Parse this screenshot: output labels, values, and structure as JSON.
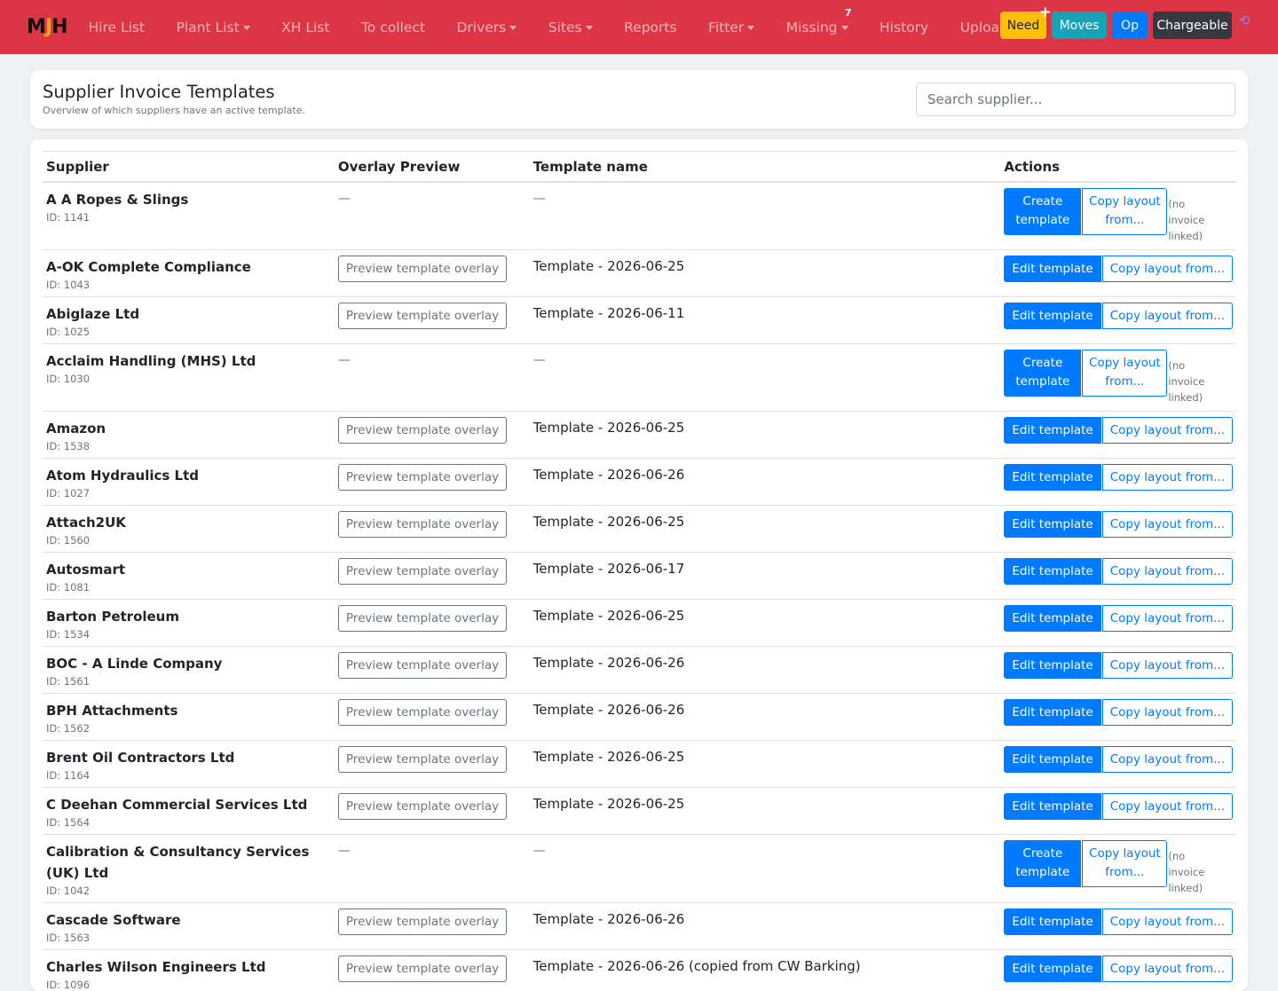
{
  "logo": {
    "left": "M",
    "mid": "J",
    "right": "H"
  },
  "nav": {
    "items": [
      {
        "label": "Hire List",
        "caret": false
      },
      {
        "label": "Plant List",
        "caret": true
      },
      {
        "label": "XH List",
        "caret": false
      },
      {
        "label": "To collect",
        "caret": false
      },
      {
        "label": "Drivers",
        "caret": true
      },
      {
        "label": "Sites",
        "caret": true
      },
      {
        "label": "Reports",
        "caret": false
      },
      {
        "label": "Fitter",
        "caret": true
      },
      {
        "label": "Missing",
        "caret": true,
        "count": "7"
      },
      {
        "label": "History",
        "caret": false
      },
      {
        "label": "Uploads",
        "caret": false
      }
    ],
    "badges": {
      "need": "Need",
      "need_plus": "+",
      "moves": "Moves",
      "op": "Op",
      "chargeable": "Chargeable"
    },
    "history_icon": "history-icon"
  },
  "header": {
    "title": "Supplier Invoice Templates",
    "subtitle": "Overview of which suppliers have an active template.",
    "search_placeholder": "Search supplier..."
  },
  "table": {
    "columns": {
      "supplier": "Supplier",
      "preview": "Overlay Preview",
      "template": "Template name",
      "actions": "Actions"
    },
    "labels": {
      "preview_btn": "Preview template overlay",
      "edit_btn": "Edit template",
      "create_btn": "Create template",
      "copy_btn": "Copy layout from...",
      "no_invoice": "(no invoice linked)",
      "dash": "—"
    },
    "rows": [
      {
        "name": "A A Ropes & Slings",
        "id": "ID: 1141",
        "template": ""
      },
      {
        "name": "A-OK Complete Compliance",
        "id": "ID: 1043",
        "template": "Template - 2026-06-25"
      },
      {
        "name": "Abiglaze Ltd",
        "id": "ID: 1025",
        "template": "Template - 2026-06-11"
      },
      {
        "name": "Acclaim Handling (MHS) Ltd",
        "id": "ID: 1030",
        "template": ""
      },
      {
        "name": "Amazon",
        "id": "ID: 1538",
        "template": "Template - 2026-06-25"
      },
      {
        "name": "Atom Hydraulics Ltd",
        "id": "ID: 1027",
        "template": "Template - 2026-06-26"
      },
      {
        "name": "Attach2UK",
        "id": "ID: 1560",
        "template": "Template - 2026-06-25"
      },
      {
        "name": "Autosmart",
        "id": "ID: 1081",
        "template": "Template - 2026-06-17"
      },
      {
        "name": "Barton Petroleum",
        "id": "ID: 1534",
        "template": "Template - 2026-06-25"
      },
      {
        "name": "BOC - A Linde Company",
        "id": "ID: 1561",
        "template": "Template - 2026-06-26"
      },
      {
        "name": "BPH Attachments",
        "id": "ID: 1562",
        "template": "Template - 2026-06-26"
      },
      {
        "name": "Brent Oil Contractors Ltd",
        "id": "ID: 1164",
        "template": "Template - 2026-06-25"
      },
      {
        "name": "C Deehan Commercial Services Ltd",
        "id": "ID: 1564",
        "template": "Template - 2026-06-25"
      },
      {
        "name": "Calibration & Consultancy Services (UK) Ltd",
        "id": "ID: 1042",
        "template": ""
      },
      {
        "name": "Cascade Software",
        "id": "ID: 1563",
        "template": "Template - 2026-06-26"
      },
      {
        "name": "Charles Wilson Engineers Ltd",
        "id": "ID: 1096",
        "template": "Template - 2026-06-26 (copied from CW Barking)"
      },
      {
        "name": "",
        "id": "",
        "template": ""
      }
    ]
  }
}
